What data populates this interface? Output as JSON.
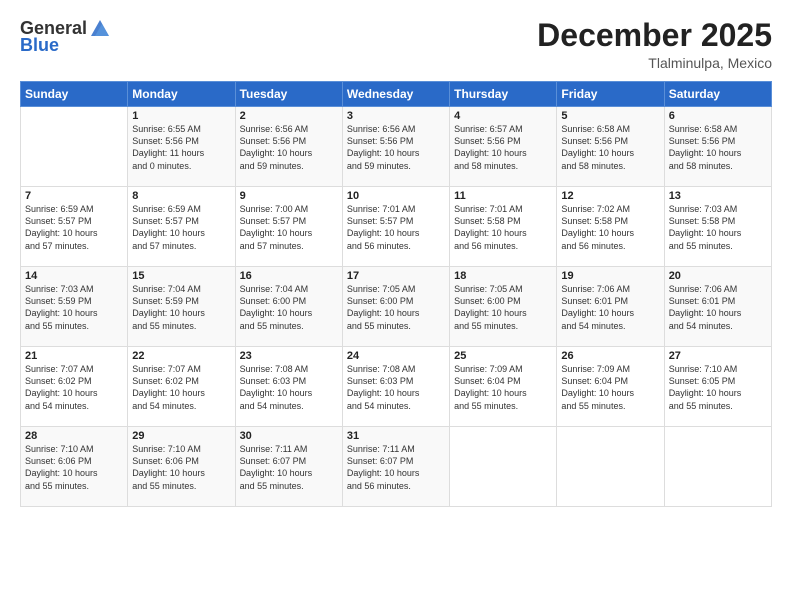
{
  "header": {
    "logo_general": "General",
    "logo_blue": "Blue",
    "month_title": "December 2025",
    "location": "Tlalminulpa, Mexico"
  },
  "days_of_week": [
    "Sunday",
    "Monday",
    "Tuesday",
    "Wednesday",
    "Thursday",
    "Friday",
    "Saturday"
  ],
  "weeks": [
    [
      {
        "day": "",
        "info": ""
      },
      {
        "day": "1",
        "info": "Sunrise: 6:55 AM\nSunset: 5:56 PM\nDaylight: 11 hours\nand 0 minutes."
      },
      {
        "day": "2",
        "info": "Sunrise: 6:56 AM\nSunset: 5:56 PM\nDaylight: 10 hours\nand 59 minutes."
      },
      {
        "day": "3",
        "info": "Sunrise: 6:56 AM\nSunset: 5:56 PM\nDaylight: 10 hours\nand 59 minutes."
      },
      {
        "day": "4",
        "info": "Sunrise: 6:57 AM\nSunset: 5:56 PM\nDaylight: 10 hours\nand 58 minutes."
      },
      {
        "day": "5",
        "info": "Sunrise: 6:58 AM\nSunset: 5:56 PM\nDaylight: 10 hours\nand 58 minutes."
      },
      {
        "day": "6",
        "info": "Sunrise: 6:58 AM\nSunset: 5:56 PM\nDaylight: 10 hours\nand 58 minutes."
      }
    ],
    [
      {
        "day": "7",
        "info": "Sunrise: 6:59 AM\nSunset: 5:57 PM\nDaylight: 10 hours\nand 57 minutes."
      },
      {
        "day": "8",
        "info": "Sunrise: 6:59 AM\nSunset: 5:57 PM\nDaylight: 10 hours\nand 57 minutes."
      },
      {
        "day": "9",
        "info": "Sunrise: 7:00 AM\nSunset: 5:57 PM\nDaylight: 10 hours\nand 57 minutes."
      },
      {
        "day": "10",
        "info": "Sunrise: 7:01 AM\nSunset: 5:57 PM\nDaylight: 10 hours\nand 56 minutes."
      },
      {
        "day": "11",
        "info": "Sunrise: 7:01 AM\nSunset: 5:58 PM\nDaylight: 10 hours\nand 56 minutes."
      },
      {
        "day": "12",
        "info": "Sunrise: 7:02 AM\nSunset: 5:58 PM\nDaylight: 10 hours\nand 56 minutes."
      },
      {
        "day": "13",
        "info": "Sunrise: 7:03 AM\nSunset: 5:58 PM\nDaylight: 10 hours\nand 55 minutes."
      }
    ],
    [
      {
        "day": "14",
        "info": "Sunrise: 7:03 AM\nSunset: 5:59 PM\nDaylight: 10 hours\nand 55 minutes."
      },
      {
        "day": "15",
        "info": "Sunrise: 7:04 AM\nSunset: 5:59 PM\nDaylight: 10 hours\nand 55 minutes."
      },
      {
        "day": "16",
        "info": "Sunrise: 7:04 AM\nSunset: 6:00 PM\nDaylight: 10 hours\nand 55 minutes."
      },
      {
        "day": "17",
        "info": "Sunrise: 7:05 AM\nSunset: 6:00 PM\nDaylight: 10 hours\nand 55 minutes."
      },
      {
        "day": "18",
        "info": "Sunrise: 7:05 AM\nSunset: 6:00 PM\nDaylight: 10 hours\nand 55 minutes."
      },
      {
        "day": "19",
        "info": "Sunrise: 7:06 AM\nSunset: 6:01 PM\nDaylight: 10 hours\nand 54 minutes."
      },
      {
        "day": "20",
        "info": "Sunrise: 7:06 AM\nSunset: 6:01 PM\nDaylight: 10 hours\nand 54 minutes."
      }
    ],
    [
      {
        "day": "21",
        "info": "Sunrise: 7:07 AM\nSunset: 6:02 PM\nDaylight: 10 hours\nand 54 minutes."
      },
      {
        "day": "22",
        "info": "Sunrise: 7:07 AM\nSunset: 6:02 PM\nDaylight: 10 hours\nand 54 minutes."
      },
      {
        "day": "23",
        "info": "Sunrise: 7:08 AM\nSunset: 6:03 PM\nDaylight: 10 hours\nand 54 minutes."
      },
      {
        "day": "24",
        "info": "Sunrise: 7:08 AM\nSunset: 6:03 PM\nDaylight: 10 hours\nand 54 minutes."
      },
      {
        "day": "25",
        "info": "Sunrise: 7:09 AM\nSunset: 6:04 PM\nDaylight: 10 hours\nand 55 minutes."
      },
      {
        "day": "26",
        "info": "Sunrise: 7:09 AM\nSunset: 6:04 PM\nDaylight: 10 hours\nand 55 minutes."
      },
      {
        "day": "27",
        "info": "Sunrise: 7:10 AM\nSunset: 6:05 PM\nDaylight: 10 hours\nand 55 minutes."
      }
    ],
    [
      {
        "day": "28",
        "info": "Sunrise: 7:10 AM\nSunset: 6:06 PM\nDaylight: 10 hours\nand 55 minutes."
      },
      {
        "day": "29",
        "info": "Sunrise: 7:10 AM\nSunset: 6:06 PM\nDaylight: 10 hours\nand 55 minutes."
      },
      {
        "day": "30",
        "info": "Sunrise: 7:11 AM\nSunset: 6:07 PM\nDaylight: 10 hours\nand 55 minutes."
      },
      {
        "day": "31",
        "info": "Sunrise: 7:11 AM\nSunset: 6:07 PM\nDaylight: 10 hours\nand 56 minutes."
      },
      {
        "day": "",
        "info": ""
      },
      {
        "day": "",
        "info": ""
      },
      {
        "day": "",
        "info": ""
      }
    ]
  ]
}
